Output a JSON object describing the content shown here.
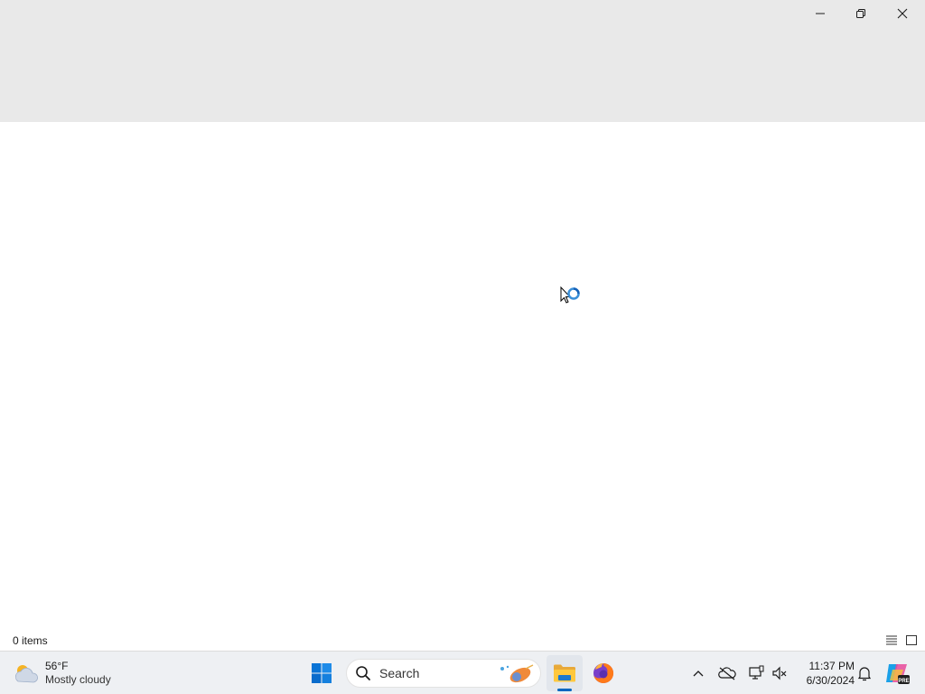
{
  "window": {
    "controls": {
      "minimize_icon": "minimize-icon",
      "restore_icon": "restore-icon",
      "close_icon": "close-icon"
    },
    "status": {
      "item_count": "0 items",
      "details_view_icon": "details-view-icon",
      "tiles_view_icon": "tiles-view-icon"
    }
  },
  "cursor": {
    "state": "working-in-background"
  },
  "taskbar": {
    "weather": {
      "temperature": "56°F",
      "condition": "Mostly cloudy",
      "icon": "partly-cloudy-icon"
    },
    "search": {
      "label": "Search"
    },
    "apps": [
      "start",
      "file-explorer",
      "firefox"
    ],
    "clock": {
      "time": "11:37 PM",
      "date": "6/30/2024"
    },
    "tray_icons": [
      "chevron-up-icon",
      "onedrive-offline-icon",
      "network-icon",
      "volume-icon",
      "notification-icon",
      "copilot-icon"
    ]
  },
  "colors": {
    "titlebar": "#e9e9e9",
    "taskbar": "#eef0f3",
    "accent": "#0067c0"
  }
}
